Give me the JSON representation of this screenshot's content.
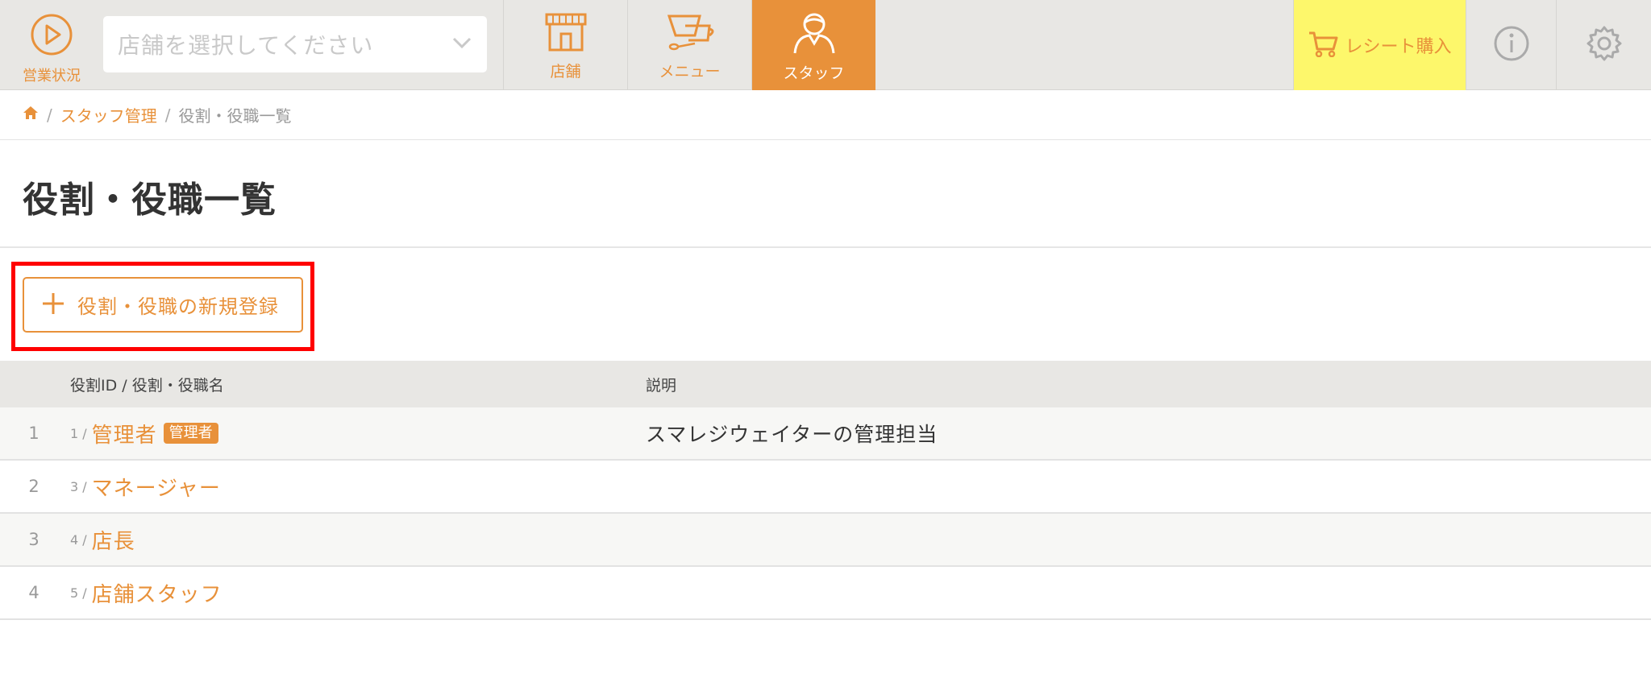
{
  "header": {
    "status_label": "営業状況",
    "store_select_placeholder": "店舗を選択してください",
    "tabs": [
      {
        "label": "店舗",
        "icon": "store-icon"
      },
      {
        "label": "メニュー",
        "icon": "menu-cup-icon"
      },
      {
        "label": "スタッフ",
        "icon": "staff-icon",
        "active": true
      }
    ],
    "receipt_button_label": "レシート購入",
    "info_icon": "info-icon",
    "settings_icon": "gear-icon"
  },
  "breadcrumb": {
    "home_icon": "home-icon",
    "items": [
      "スタッフ管理",
      "役割・役職一覧"
    ]
  },
  "page": {
    "title": "役割・役職一覧",
    "add_button_label": "役割・役職の新規登録"
  },
  "table": {
    "headers": {
      "name": "役割ID / 役割・役職名",
      "description": "説明"
    },
    "rows": [
      {
        "num": "1",
        "id": "1 /",
        "name": "管理者",
        "badge": "管理者",
        "description": "スマレジウェイターの管理担当"
      },
      {
        "num": "2",
        "id": "3 /",
        "name": "マネージャー",
        "badge": "",
        "description": ""
      },
      {
        "num": "3",
        "id": "4 /",
        "name": "店長",
        "badge": "",
        "description": ""
      },
      {
        "num": "4",
        "id": "5 /",
        "name": "店舗スタッフ",
        "badge": "",
        "description": ""
      }
    ]
  },
  "colors": {
    "accent": "#e8913a",
    "header_bg": "#e8e7e4",
    "receipt_bg": "#fdf76b",
    "highlight": "#ff0000"
  }
}
